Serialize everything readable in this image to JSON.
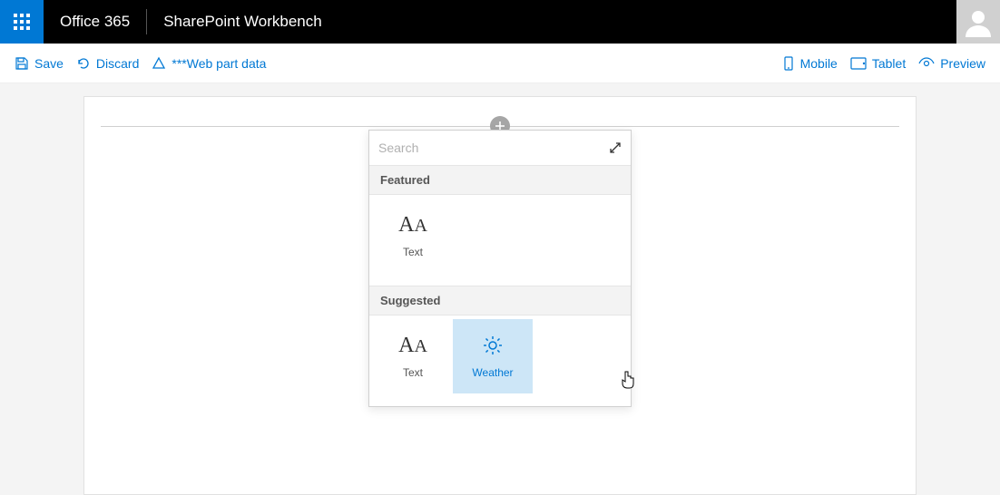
{
  "header": {
    "brand": "Office 365",
    "app_title": "SharePoint Workbench"
  },
  "commands": {
    "save": "Save",
    "discard": "Discard",
    "webpart_data": "***Web part data",
    "mobile": "Mobile",
    "tablet": "Tablet",
    "preview": "Preview"
  },
  "toolbox": {
    "search_placeholder": "Search",
    "sections": {
      "featured": {
        "title": "Featured",
        "items": [
          {
            "label": "Text",
            "icon": "text-icon"
          }
        ]
      },
      "suggested": {
        "title": "Suggested",
        "items": [
          {
            "label": "Text",
            "icon": "text-icon"
          },
          {
            "label": "Weather",
            "icon": "sun-icon",
            "selected": true
          }
        ]
      }
    }
  },
  "colors": {
    "accent": "#0078d4",
    "hover": "#cde6f7"
  }
}
